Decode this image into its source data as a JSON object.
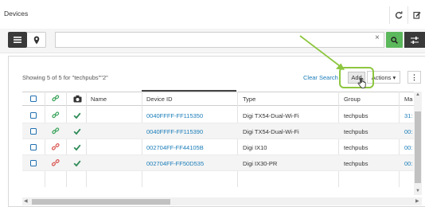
{
  "window": {
    "title": "Devices"
  },
  "titlebar": {
    "refresh_icon": "refresh-icon",
    "edit_icon": "edit-icon"
  },
  "toolbar": {
    "view_list_icon": "list-icon",
    "view_map_icon": "map-pin-icon",
    "search_value": "",
    "clear_glyph": "×",
    "search_icon": "search-icon",
    "filter_icon": "sliders-icon"
  },
  "panel": {
    "showing_text": "Showing 5 of 5 for \"techpubs\"\"2\"",
    "clear_search_label": "Clear Search",
    "add_label": "Add",
    "actions_label": "Actions ▾",
    "more_label": "⋮"
  },
  "table": {
    "headers": {
      "select": "",
      "link": "link-icon",
      "camera": "camera-icon",
      "name": "Name",
      "device_id": "Device ID",
      "type": "Type",
      "group": "Group",
      "mac": "Ma"
    },
    "rows": [
      {
        "link_state": "connected",
        "device_id": "0040FFFF-FF115350",
        "type": "Digi TX54-Dual-Wi-Fi",
        "group": "techpubs",
        "mac": "31:"
      },
      {
        "link_state": "connected",
        "device_id": "0040FFFF-FF115390",
        "type": "Digi TX54-Dual-Wi-Fi",
        "group": "techpubs",
        "mac": "00:"
      },
      {
        "link_state": "disconnected",
        "device_id": "002704FF-FF44105B",
        "type": "Digi IX10",
        "group": "techpubs",
        "mac": "00:"
      },
      {
        "link_state": "disconnected",
        "device_id": "002704FF-FF50D535",
        "type": "Digi IX30-PR",
        "group": "techpubs",
        "mac": "00:"
      }
    ]
  },
  "colors": {
    "accent_green": "#5cb85c",
    "highlight_green": "#8dc63f",
    "link_blue": "#1a7cb8",
    "connected_green": "#3aa35a",
    "disconnected_red": "#d9534f",
    "dark": "#3a3a3a"
  }
}
